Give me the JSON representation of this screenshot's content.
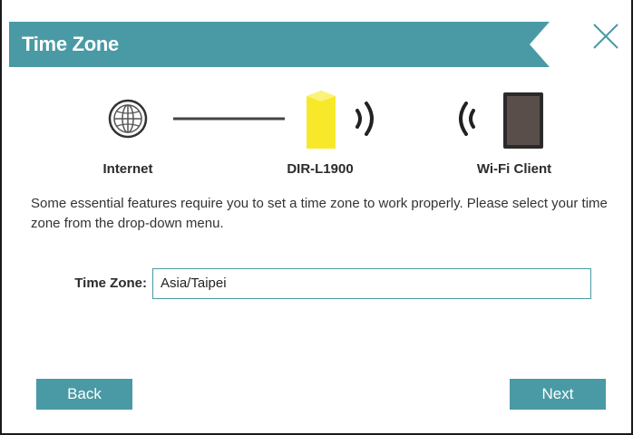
{
  "dialog": {
    "title": "Time Zone",
    "close_icon": "close-x-icon"
  },
  "diagram": {
    "nodes": [
      {
        "label": "Internet",
        "icon": "globe-icon"
      },
      {
        "label": "DIR-L1900",
        "icon": "router-icon"
      },
      {
        "label": "Wi-Fi Client",
        "icon": "tablet-icon"
      }
    ],
    "router_color": "#f7e92a"
  },
  "description": "Some essential features require you to set a time zone to work properly. Please select your time zone from the drop-down menu.",
  "time_zone": {
    "label": "Time Zone:",
    "value": "Asia/Taipei"
  },
  "buttons": {
    "back": "Back",
    "next": "Next"
  },
  "colors": {
    "accent": "#4a9aa5",
    "title_text": "#ffffff"
  }
}
